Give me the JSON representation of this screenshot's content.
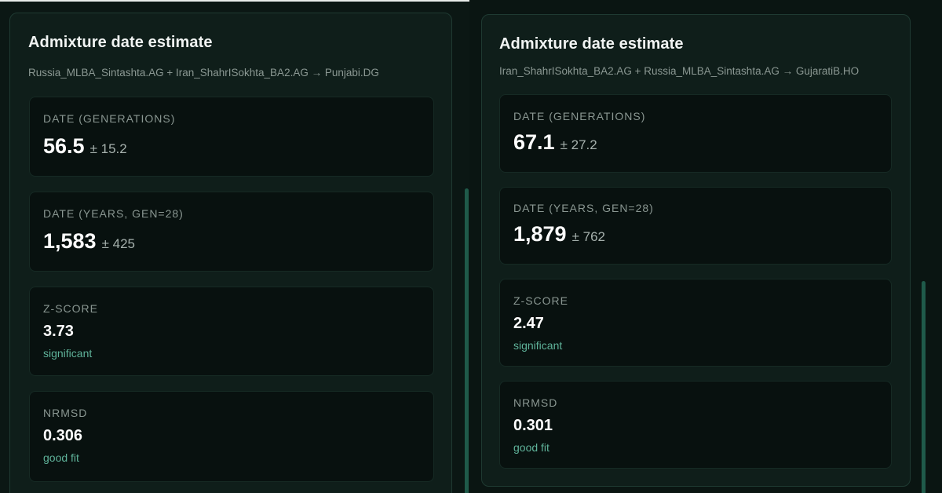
{
  "panels": [
    {
      "title": "Admixture date estimate",
      "subtitle": "Russia_MLBA_Sintashta.AG + Iran_ShahrISokhta_BA2.AG → Punjabi.DG",
      "date_generations": {
        "label": "DATE (GENERATIONS)",
        "value": "56.5",
        "error": "± 15.2"
      },
      "date_years": {
        "label": "DATE (YEARS, GEN=28)",
        "value": "1,583",
        "error": "± 425"
      },
      "z_score": {
        "label": "Z-SCORE",
        "value": "3.73",
        "note": "significant"
      },
      "nrmsd": {
        "label": "NRMSD",
        "value": "0.306",
        "note": "good fit"
      }
    },
    {
      "title": "Admixture date estimate",
      "subtitle": "Iran_ShahrISokhta_BA2.AG + Russia_MLBA_Sintashta.AG → GujaratiB.HO",
      "date_generations": {
        "label": "DATE (GENERATIONS)",
        "value": "67.1",
        "error": "± 27.2"
      },
      "date_years": {
        "label": "DATE (YEARS, GEN=28)",
        "value": "1,879",
        "error": "± 762"
      },
      "z_score": {
        "label": "Z-SCORE",
        "value": "2.47",
        "note": "significant"
      },
      "nrmsd": {
        "label": "NRMSD",
        "value": "0.301",
        "note": "good fit"
      }
    }
  ],
  "colors": {
    "background": "#0a1512",
    "panel": "#0f1e1a",
    "card": "#08110f",
    "accent_text": "#5fb39a",
    "scrollbar": "#1f5a4a"
  }
}
